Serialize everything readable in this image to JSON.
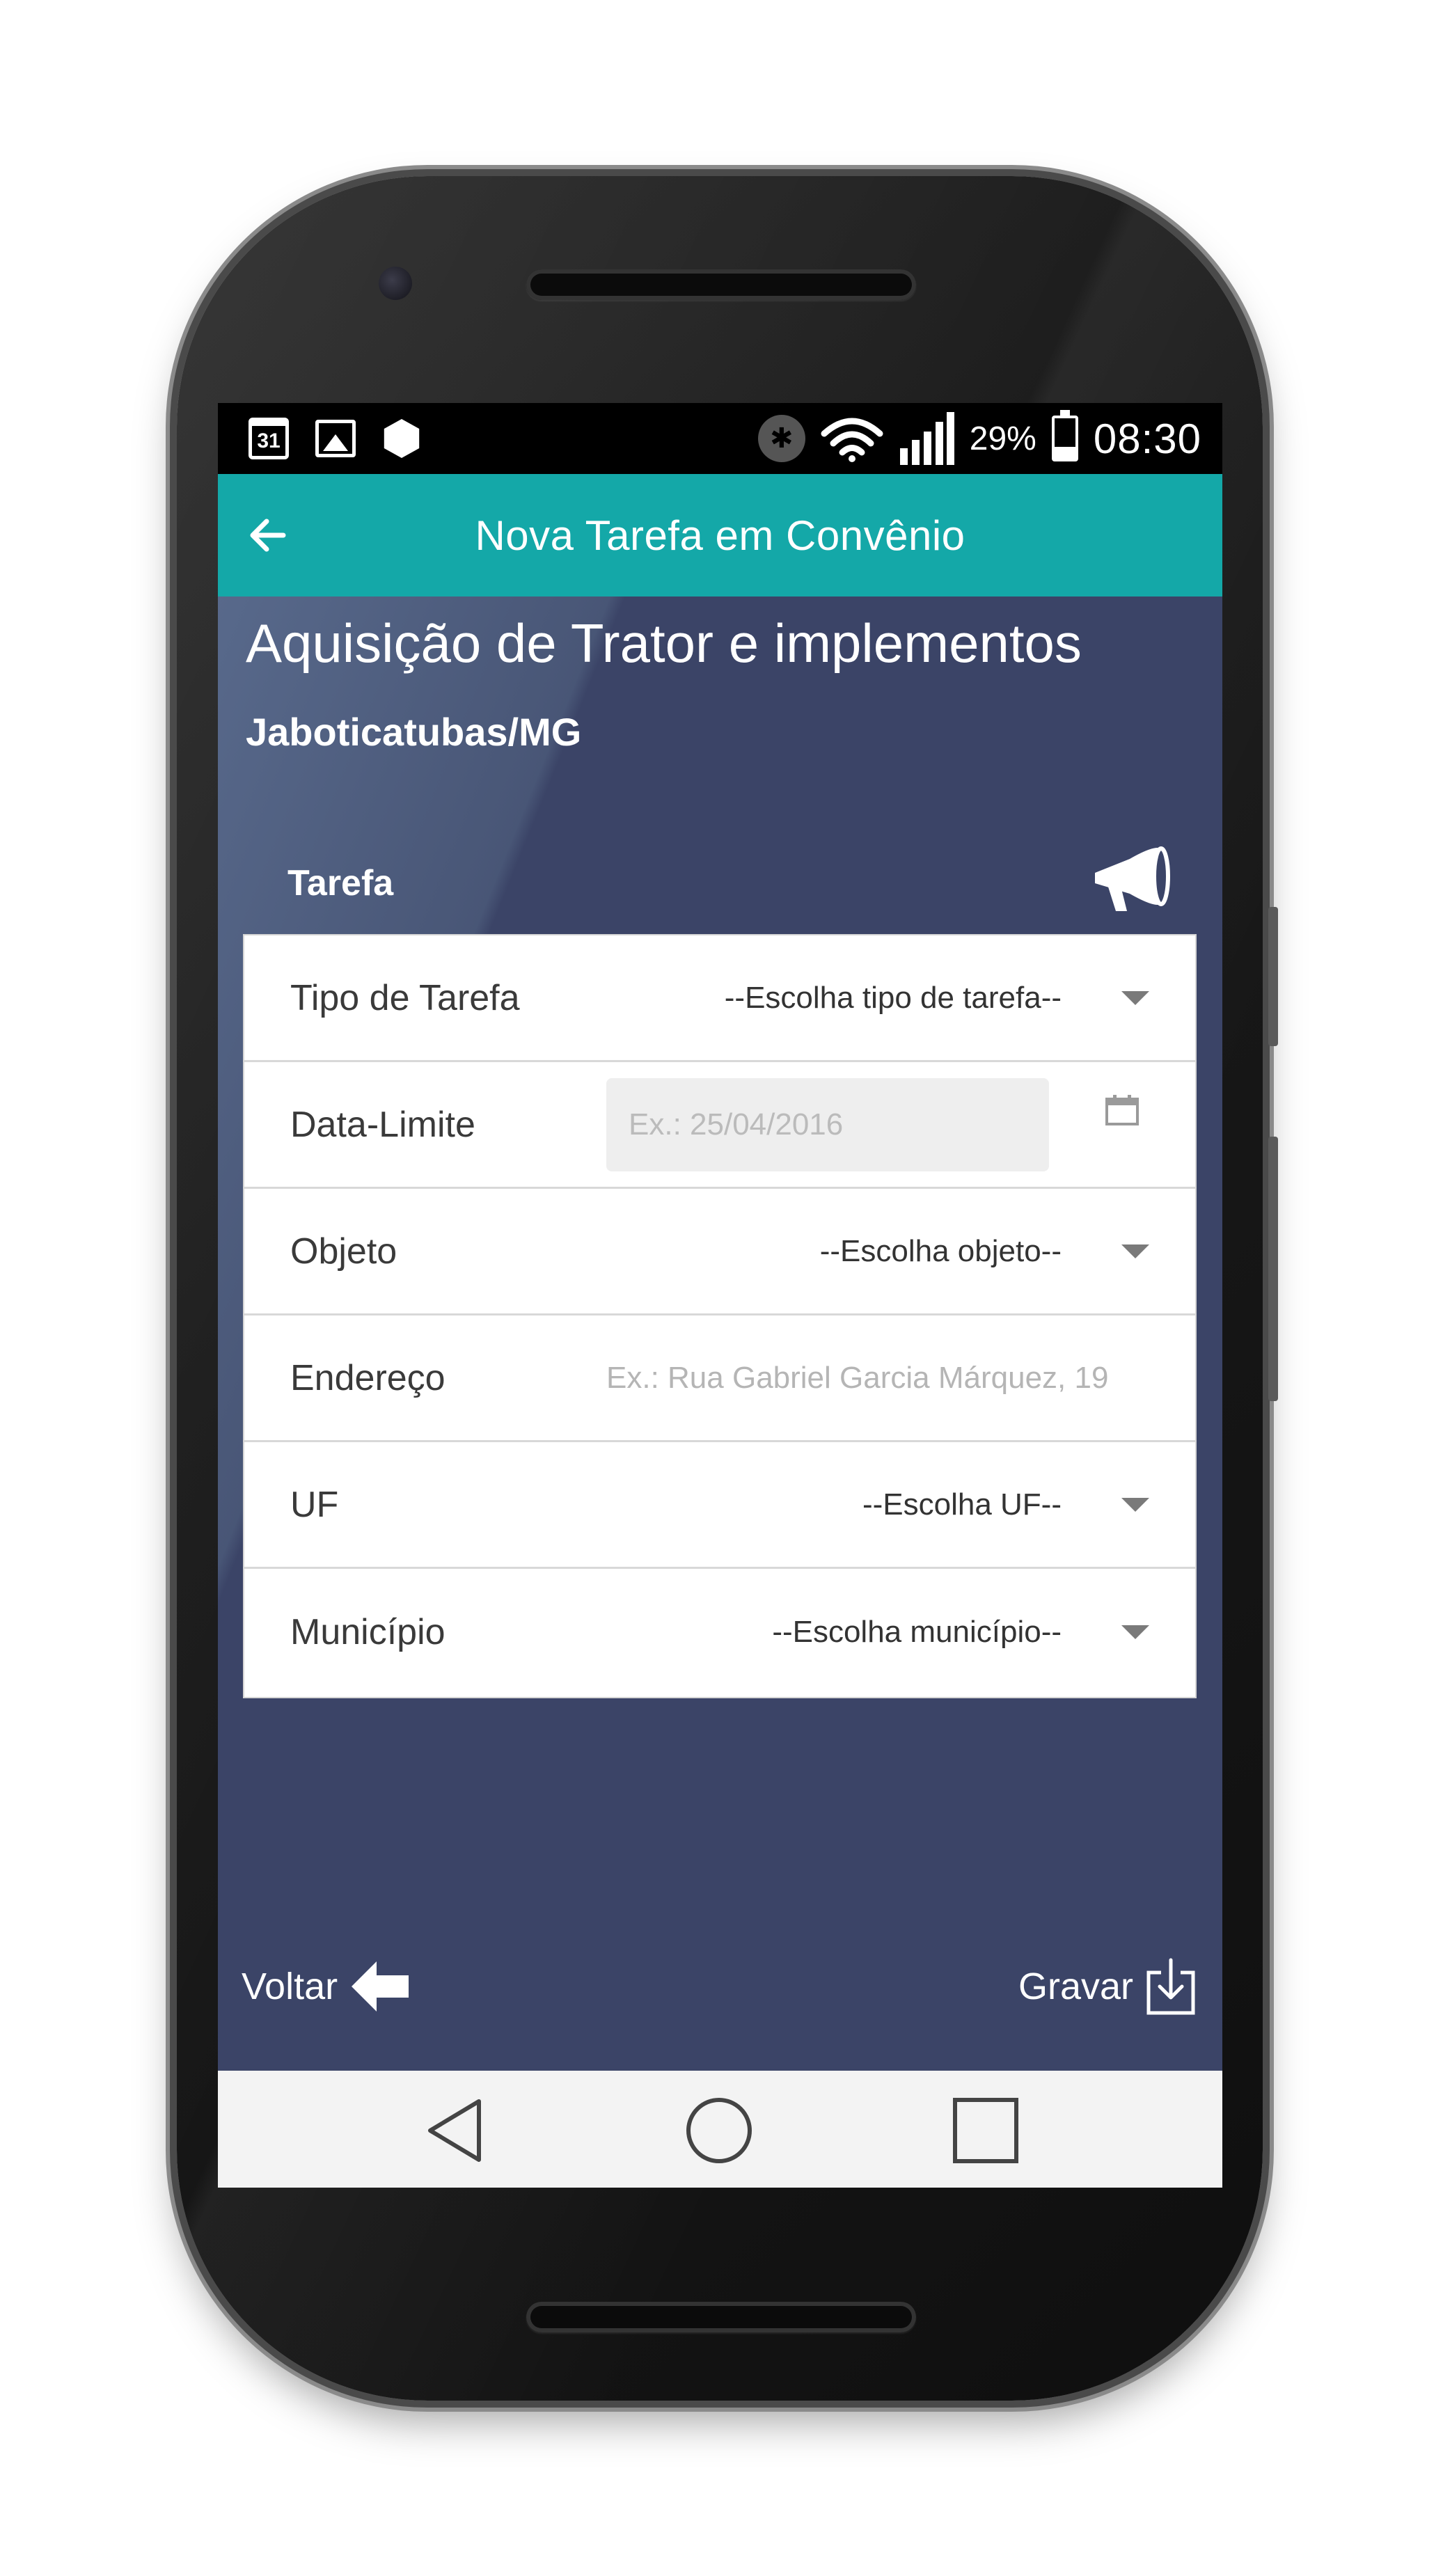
{
  "status_bar": {
    "calendar_day": "31",
    "battery_percent": "29%",
    "battery_level": 0.29,
    "time": "08:30",
    "icons": [
      "calendar-icon",
      "image-icon",
      "hex-app-icon",
      "bluetooth-icon",
      "wifi-icon",
      "signal-icon",
      "battery-icon"
    ]
  },
  "app_bar": {
    "title": "Nova Tarefa em Convênio",
    "back_icon": "arrow-left-icon"
  },
  "header": {
    "title": "Aquisição de Trator e implementos",
    "subtitle": "Jaboticatubas/MG"
  },
  "section": {
    "label": "Tarefa",
    "icon": "megaphone-icon"
  },
  "form": {
    "tipo_tarefa": {
      "label": "Tipo de Tarefa",
      "value": "--Escolha tipo de tarefa--"
    },
    "data_limite": {
      "label": "Data-Limite",
      "placeholder": "Ex.: 25/04/2016"
    },
    "objeto": {
      "label": "Objeto",
      "value": "--Escolha objeto--"
    },
    "endereco": {
      "label": "Endereço",
      "placeholder": "Ex.: Rua Gabriel Garcia Márquez, 19"
    },
    "uf": {
      "label": "UF",
      "value": "--Escolha UF--"
    },
    "municipio": {
      "label": "Município",
      "value": "--Escolha município--"
    }
  },
  "actions": {
    "voltar": "Voltar",
    "gravar": "Gravar"
  },
  "colors": {
    "app_bar": "#14a8a8",
    "background": "#3b4467",
    "nav_bar": "#f3f3f3"
  }
}
